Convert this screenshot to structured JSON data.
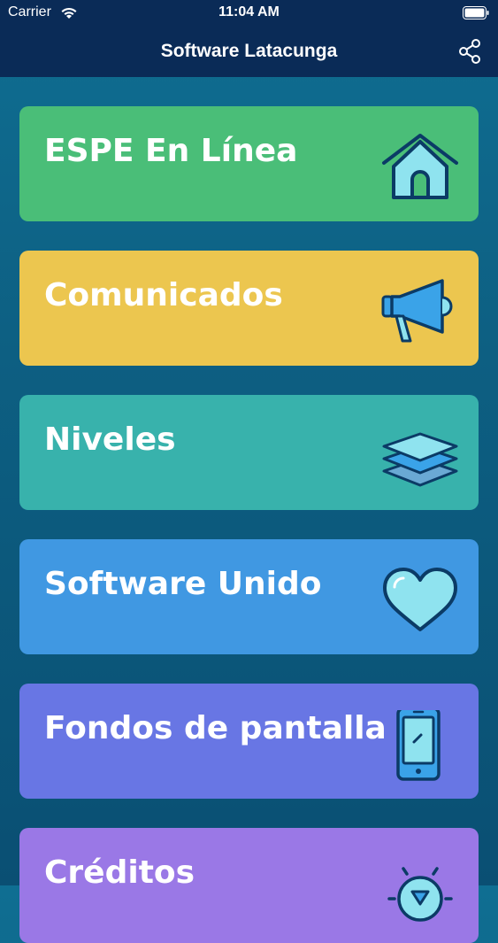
{
  "status_bar": {
    "carrier": "Carrier",
    "time": "11:04 AM"
  },
  "navbar": {
    "title": "Software Latacunga"
  },
  "menu": [
    {
      "label": "ESPE En Línea",
      "color": "#4abe78",
      "icon": "house-icon"
    },
    {
      "label": "Comunicados",
      "color": "#ecc64f",
      "icon": "megaphone-icon"
    },
    {
      "label": "Niveles",
      "color": "#38b2ac",
      "icon": "layers-icon"
    },
    {
      "label": "Software Unido",
      "color": "#4098e2",
      "icon": "heart-icon"
    },
    {
      "label": "Fondos de pantalla",
      "color": "#6876e4",
      "icon": "phone-icon"
    },
    {
      "label": "Créditos",
      "color": "#9a78e6",
      "icon": "lightbulb-icon"
    }
  ]
}
